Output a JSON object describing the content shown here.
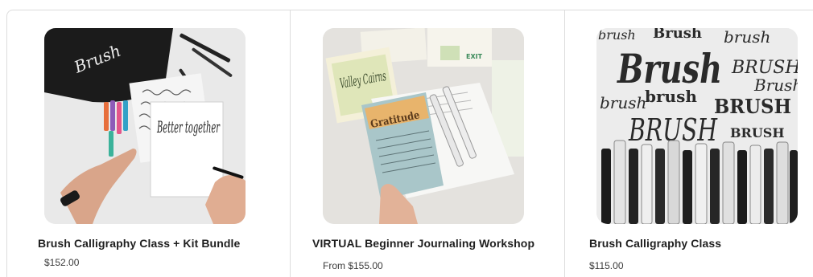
{
  "products": [
    {
      "title": "Brush Calligraphy Class + Kit Bundle",
      "price": "$152.00",
      "image_icon": "calligraphy-kit-photo"
    },
    {
      "title": "VIRTUAL Beginner Journaling Workshop",
      "price": "From $155.00",
      "image_icon": "journaling-photo"
    },
    {
      "title": "Brush Calligraphy Class",
      "price": "$115.00",
      "image_icon": "brush-pens-photo"
    }
  ],
  "artwork": {
    "card1": {
      "pouch": "Brush",
      "pad": "Better together"
    },
    "card2": {
      "left_page": "Valley Cairns",
      "banner": "Gratitude",
      "sticker": "EXIT"
    },
    "card3": {
      "words": [
        "brush",
        "Brush",
        "brush",
        "Brush",
        "BRUSH",
        "Brush",
        "brush",
        "brush",
        "BRUSH",
        "BRUSH",
        "BRUSH"
      ]
    }
  },
  "colors": {
    "title": "#1f1f1f",
    "price": "#3a3a3a",
    "border": "#dcdcdc"
  }
}
